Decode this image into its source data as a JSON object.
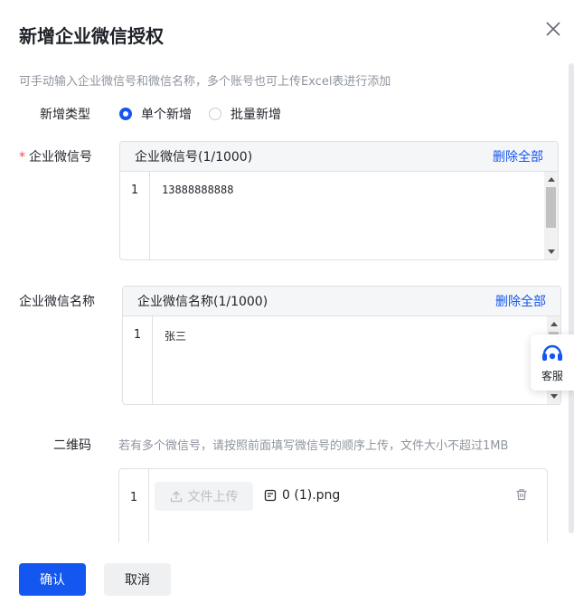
{
  "dialog": {
    "title": "新增企业微信授权",
    "hint": "可手动输入企业微信号和微信名称，多个账号也可上传Excel表进行添加"
  },
  "add_type": {
    "label": "新增类型",
    "options": [
      "单个新增",
      "批量新增"
    ],
    "selected": "单个新增"
  },
  "wechat_id": {
    "required_mark": "*",
    "label": "企业微信号",
    "header": "企业微信号(1/1000)",
    "delete_all": "删除全部",
    "line_number": "1",
    "value": "13888888888"
  },
  "wechat_name": {
    "label": "企业微信名称",
    "header": "企业微信名称(1/1000)",
    "delete_all": "删除全部",
    "line_number": "1",
    "value": "张三"
  },
  "qrcode": {
    "label": "二维码",
    "hint": "若有多个微信号，请按照前面填写微信号的顺序上传，文件大小不超过1MB",
    "line_number": "1",
    "upload_label": "文件上传",
    "file_name": "0 (1).png"
  },
  "customer_service": {
    "label": "客服"
  },
  "footer": {
    "confirm": "确认",
    "cancel": "取消"
  },
  "colors": {
    "primary": "#1456f0",
    "required": "#f54a45"
  }
}
